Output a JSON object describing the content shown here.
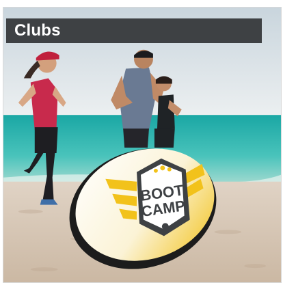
{
  "card": {
    "title": "Clubs",
    "title_bar_color": "#3e4144"
  },
  "banner": {
    "text_line1": "BOOT",
    "text_line2": "CAMP",
    "accent_color": "#f2c21b",
    "emblem_color": "#3e4144"
  },
  "scene": {
    "sky_color": "#dfe6ea",
    "sea_color": "#2bb3ad",
    "sand_color": "#d8c8b6"
  }
}
